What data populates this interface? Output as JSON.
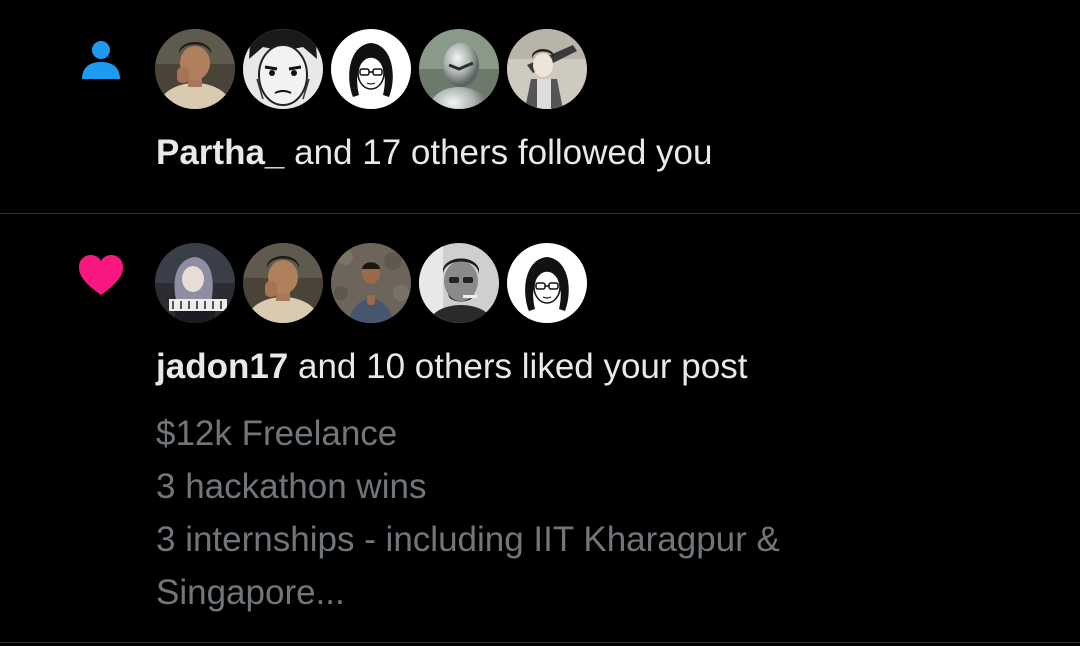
{
  "colors": {
    "background": "#000000",
    "divider": "#2f3336",
    "primary_text": "#e7e9ea",
    "secondary_text": "#71767b",
    "follow_icon": "#1d9bf0",
    "like_icon": "#f91880"
  },
  "notifications": [
    {
      "type": "follow",
      "icon": "person-icon",
      "avatars": [
        "avatar-1",
        "avatar-2",
        "avatar-3",
        "avatar-4",
        "avatar-5"
      ],
      "actor": "Partha_",
      "summary_rest": " and 17 others followed you"
    },
    {
      "type": "like",
      "icon": "heart-icon",
      "avatars": [
        "avatar-1",
        "avatar-2",
        "avatar-3",
        "avatar-4",
        "avatar-5"
      ],
      "actor": "jadon17",
      "summary_rest": " and 10 others liked your post",
      "post_preview": [
        "$12k Freelance",
        "3 hackathon wins",
        "3 internships - including IIT Kharagpur &",
        "Singapore..."
      ]
    }
  ]
}
